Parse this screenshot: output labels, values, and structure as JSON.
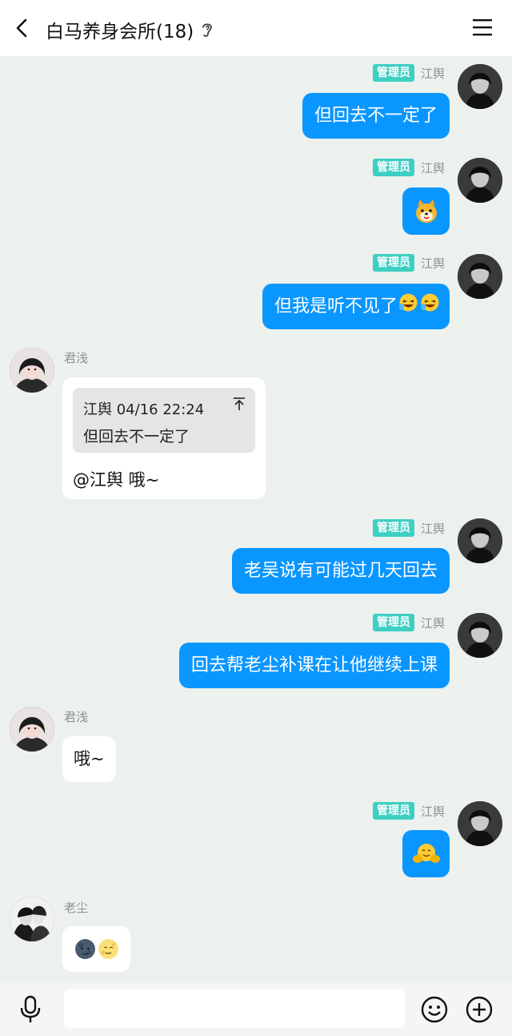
{
  "header": {
    "title": "白马养身会所(18)"
  },
  "messages": [
    {
      "sender": "江舆",
      "badge": "管理员",
      "text": "但回去不一定了"
    },
    {
      "sender": "江舆",
      "badge": "管理员",
      "emoji": "dog-face-sticker"
    },
    {
      "sender": "江舆",
      "badge": "管理员",
      "text": "但我是听不见了"
    },
    {
      "sender": "君浅",
      "quote": {
        "author_time": "江舆 04/16 22:24",
        "text": "但回去不一定了"
      },
      "text": "@江舆 哦~"
    },
    {
      "sender": "江舆",
      "badge": "管理员",
      "text": "老吴说有可能过几天回去"
    },
    {
      "sender": "江舆",
      "badge": "管理员",
      "text": "回去帮老尘补课在让他继续上课"
    },
    {
      "sender": "君浅",
      "text": "哦~"
    },
    {
      "sender": "江舆",
      "badge": "管理员",
      "emoji": "hug-face-sticker"
    },
    {
      "sender": "老尘",
      "emojis": [
        "new-moon-face",
        "full-moon-face"
      ]
    }
  ],
  "colors": {
    "bubble_out": "#0a96ff",
    "badge": "#3ecfc3",
    "background": "#ecf1ed"
  }
}
